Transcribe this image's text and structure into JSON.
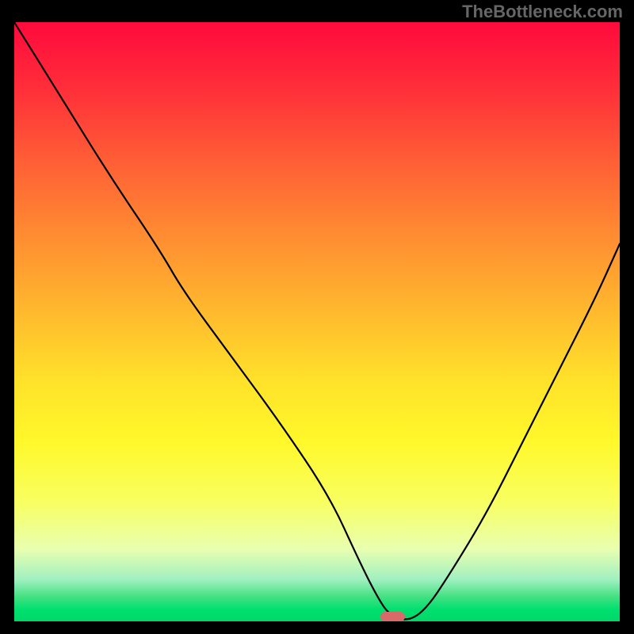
{
  "watermark": "TheBottleneck.com",
  "chart_data": {
    "type": "line",
    "title": "",
    "xlabel": "",
    "ylabel": "",
    "xlim": [
      0,
      100
    ],
    "ylim": [
      0,
      100
    ],
    "grid": false,
    "series": [
      {
        "name": "curve",
        "x": [
          0,
          8,
          16,
          24,
          28,
          36,
          44,
          52,
          57,
          60,
          62,
          65,
          68,
          72,
          78,
          84,
          90,
          96,
          100
        ],
        "values": [
          100,
          87,
          74,
          62,
          55,
          44,
          33,
          21,
          10,
          4,
          1,
          0,
          2,
          8,
          18,
          30,
          42,
          54,
          63
        ]
      }
    ],
    "marker": {
      "x": 62.5,
      "y": 0,
      "w": 4,
      "h": 1.6
    },
    "gradient_stops": [
      {
        "pct": 0,
        "color": "#ff0a3c"
      },
      {
        "pct": 10,
        "color": "#ff2a3a"
      },
      {
        "pct": 22,
        "color": "#ff5a36"
      },
      {
        "pct": 35,
        "color": "#ff8a32"
      },
      {
        "pct": 48,
        "color": "#ffb82e"
      },
      {
        "pct": 60,
        "color": "#ffe22a"
      },
      {
        "pct": 70,
        "color": "#fff82a"
      },
      {
        "pct": 80,
        "color": "#f8ff60"
      },
      {
        "pct": 88,
        "color": "#e8ffb0"
      },
      {
        "pct": 93,
        "color": "#a0f0c0"
      },
      {
        "pct": 96,
        "color": "#40e080"
      },
      {
        "pct": 98,
        "color": "#00e070"
      },
      {
        "pct": 100,
        "color": "#00d868"
      }
    ]
  }
}
